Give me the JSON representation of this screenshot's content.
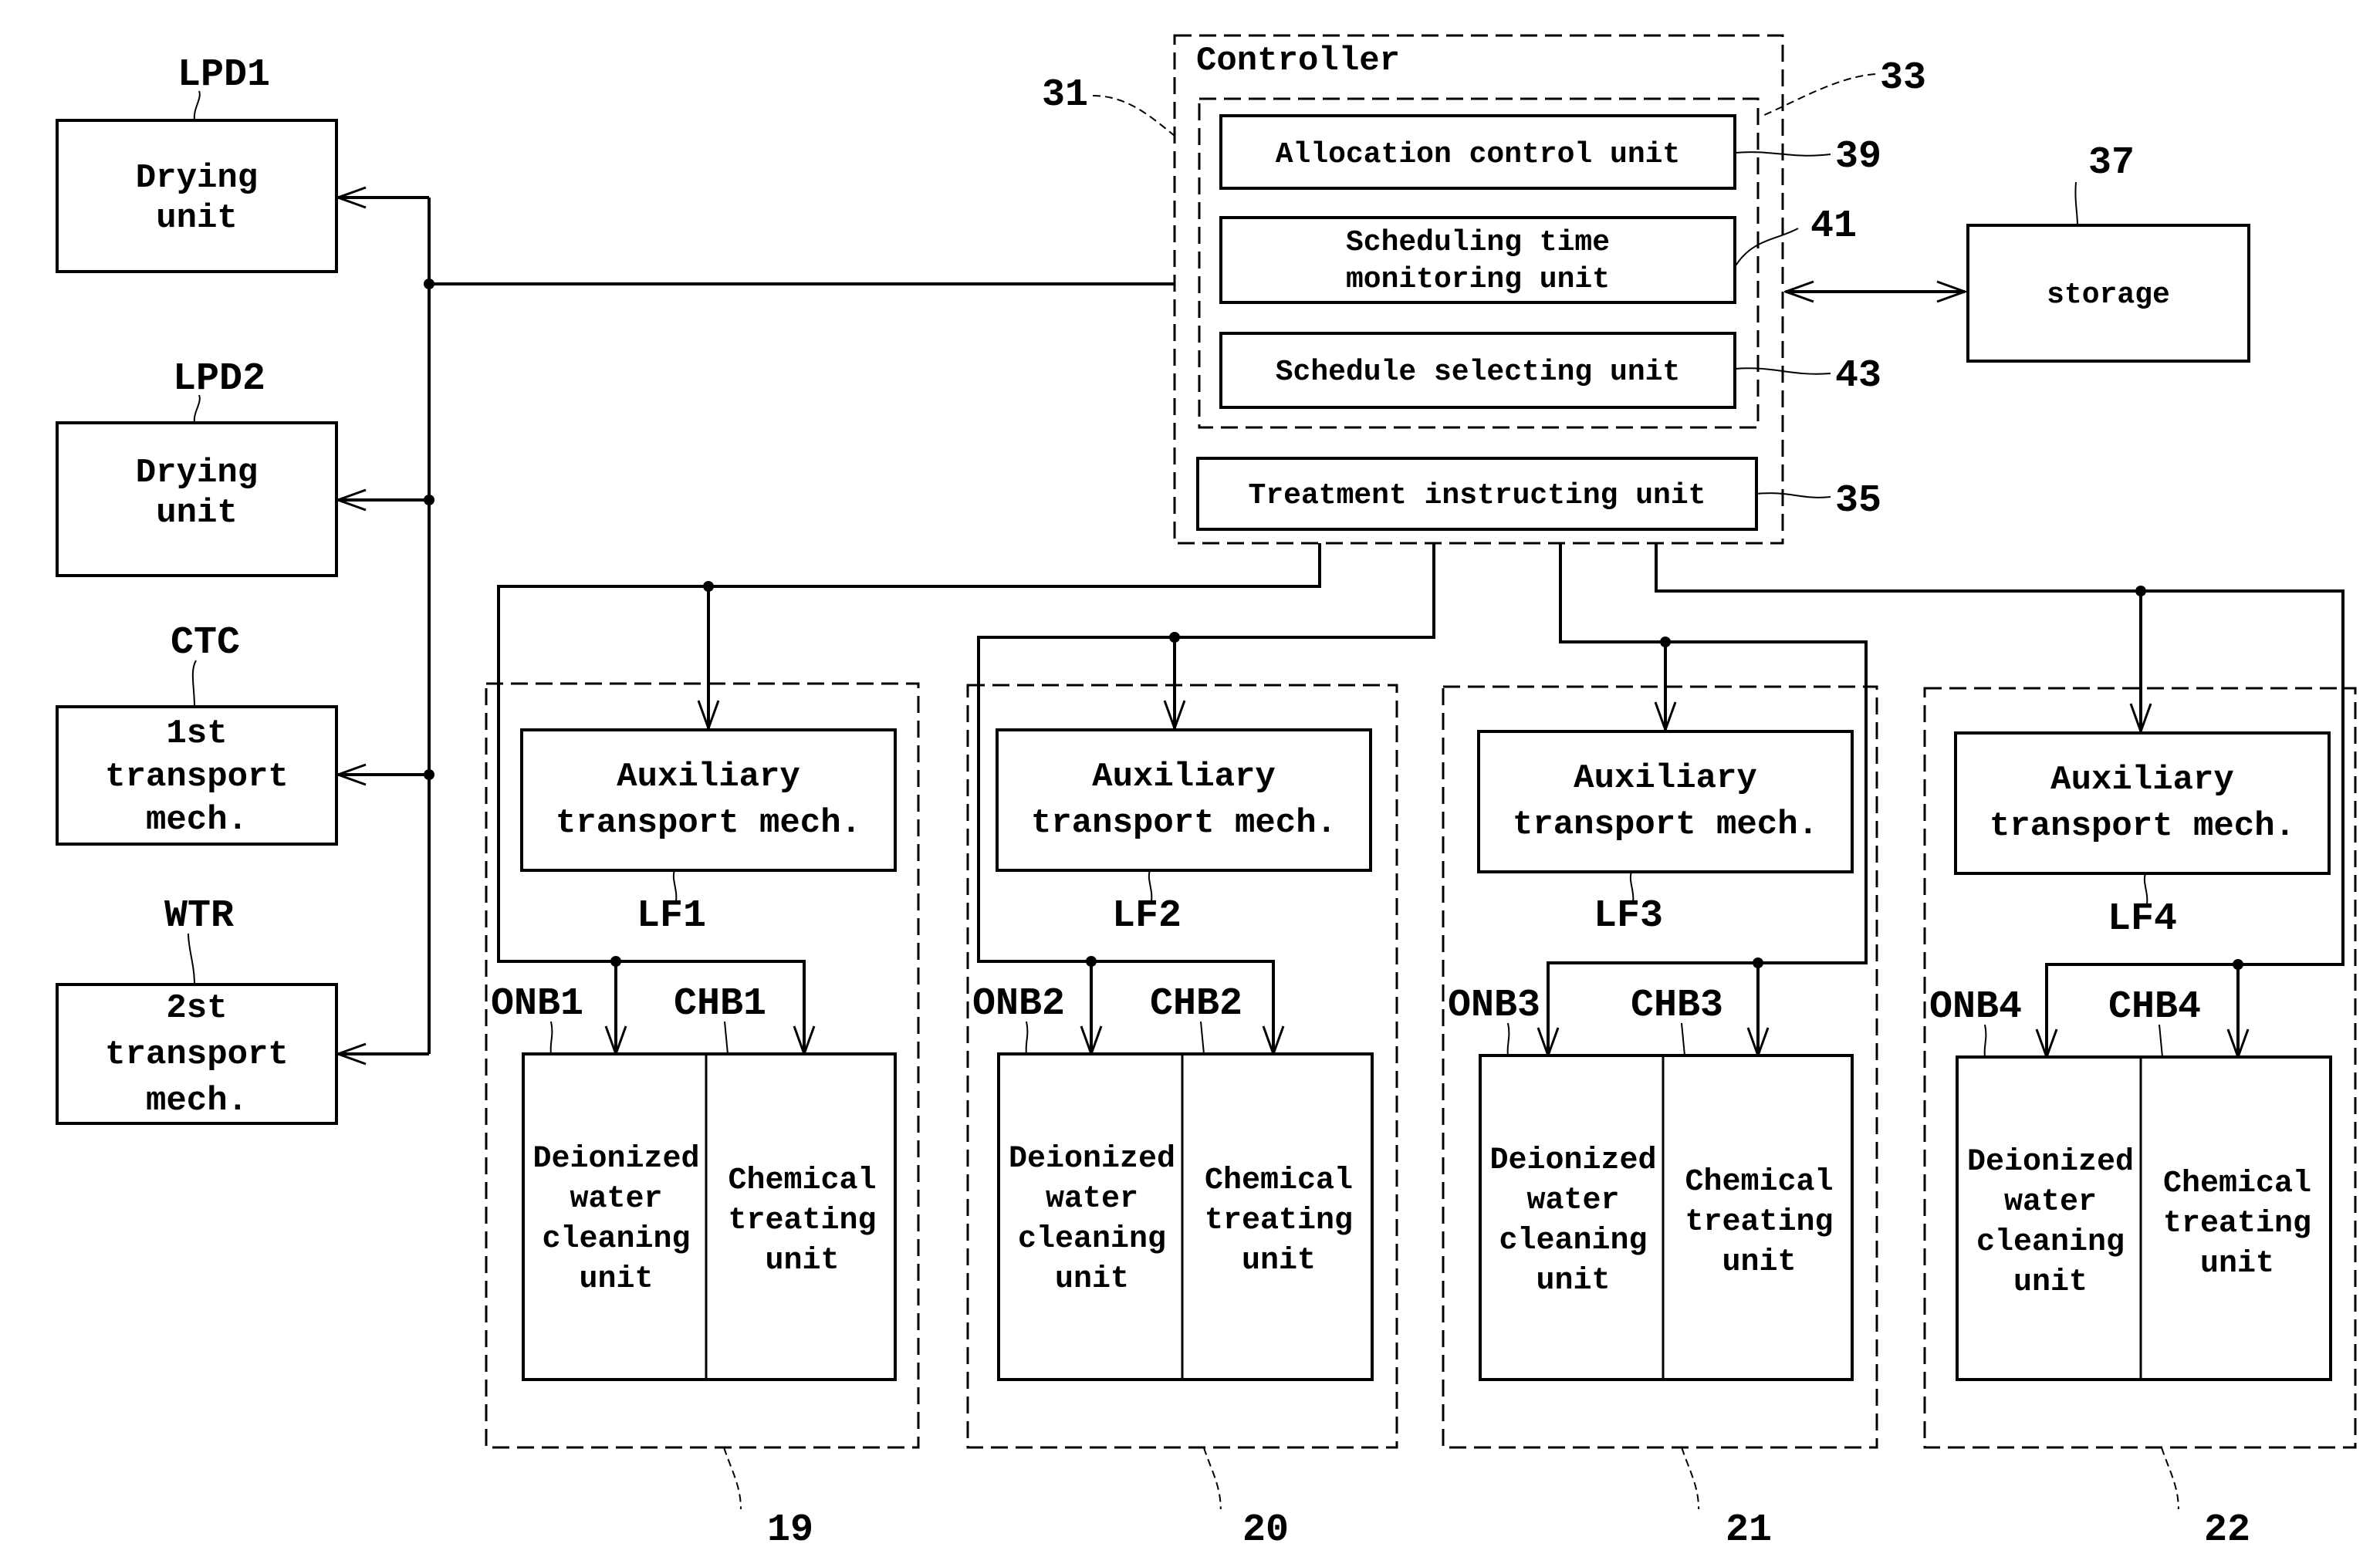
{
  "left_units": [
    {
      "ref": "LPD1",
      "lines": [
        "Drying",
        "unit"
      ]
    },
    {
      "ref": "LPD2",
      "lines": [
        "Drying",
        "unit"
      ]
    },
    {
      "ref": "CTC",
      "lines": [
        "1st",
        "transport",
        "mech."
      ]
    },
    {
      "ref": "WTR",
      "lines": [
        "2st",
        "transport",
        "mech."
      ]
    }
  ],
  "controller": {
    "title": "Controller",
    "ref": "31",
    "group_ref": "33",
    "units": [
      {
        "ref": "39",
        "lines": [
          "Allocation control unit"
        ]
      },
      {
        "ref": "41",
        "lines": [
          "Scheduling time",
          "monitoring unit"
        ]
      },
      {
        "ref": "43",
        "lines": [
          "Schedule selecting unit"
        ]
      }
    ],
    "treatment": {
      "ref": "35",
      "label": "Treatment instructing unit"
    }
  },
  "storage": {
    "ref": "37",
    "label": "storage"
  },
  "panels": [
    {
      "ref": "19",
      "lf": "LF1",
      "onb": "ONB1",
      "chb": "CHB1",
      "aux_lines": [
        "Auxiliary",
        "transport mech."
      ],
      "diw_lines": [
        "Deionized",
        "water",
        "cleaning",
        "unit"
      ],
      "chem_lines": [
        "Chemical",
        "treating",
        "unit"
      ]
    },
    {
      "ref": "20",
      "lf": "LF2",
      "onb": "ONB2",
      "chb": "CHB2",
      "aux_lines": [
        "Auxiliary",
        "transport mech."
      ],
      "diw_lines": [
        "Deionized",
        "water",
        "cleaning",
        "unit"
      ],
      "chem_lines": [
        "Chemical",
        "treating",
        "unit"
      ]
    },
    {
      "ref": "21",
      "lf": "LF3",
      "onb": "ONB3",
      "chb": "CHB3",
      "aux_lines": [
        "Auxiliary",
        "transport mech."
      ],
      "diw_lines": [
        "Deionized",
        "water",
        "cleaning",
        "unit"
      ],
      "chem_lines": [
        "Chemical",
        "treating",
        "unit"
      ]
    },
    {
      "ref": "22",
      "lf": "LF4",
      "onb": "ONB4",
      "chb": "CHB4",
      "aux_lines": [
        "Auxiliary",
        "transport mech."
      ],
      "diw_lines": [
        "Deionized",
        "water",
        "cleaning",
        "unit"
      ],
      "chem_lines": [
        "Chemical",
        "treating",
        "unit"
      ]
    }
  ]
}
